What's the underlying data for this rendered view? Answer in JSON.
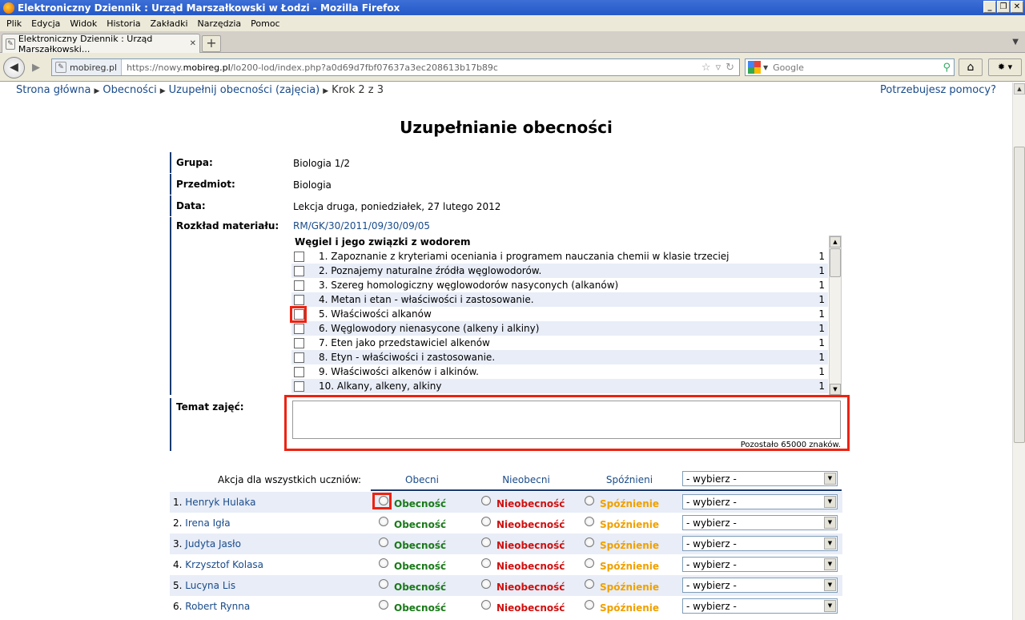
{
  "window": {
    "title": "Elektroniczny Dziennik : Urząd Marszałkowski w Łodzi - Mozilla Firefox",
    "buttons": [
      "_",
      "❐",
      "✕"
    ]
  },
  "menu": [
    "Plik",
    "Edycja",
    "Widok",
    "Historia",
    "Zakładki",
    "Narzędzia",
    "Pomoc"
  ],
  "tab": {
    "label": "Elektroniczny Dziennik : Urząd Marszałkowski..."
  },
  "urlbar": {
    "site": "mobireg.pl",
    "url_prefix": "https://nowy.",
    "url_domain": "mobireg.pl",
    "url_rest": "/lo200-lod/index.php?a0d69d7fbf07637a3ec208613b17b89c"
  },
  "search": {
    "placeholder": "Google"
  },
  "breadcrumb": {
    "items": [
      "Strona główna",
      "Obecności",
      "Uzupełnij obecności (zajęcia)"
    ],
    "current": "Krok 2 z 3"
  },
  "help_link": "Potrzebujesz pomocy?",
  "page_title": "Uzupełnianie obecności",
  "fields": {
    "group_label": "Grupa:",
    "group_value": "Biologia 1/2",
    "subject_label": "Przedmiot:",
    "subject_value": "Biologia",
    "date_label": "Data:",
    "date_value": "Lekcja druga, poniedziałek, 27 lutego 2012",
    "plan_label": "Rozkład materiału:",
    "plan_value": "RM/GK/30/2011/09/30/09/05",
    "topic_label": "Temat zajęć:"
  },
  "material": {
    "title": "Węgiel i jego związki z wodorem",
    "items": [
      {
        "label": "1. Zapoznanie z kryteriami oceniania i programem nauczania chemii w klasie trzeciej",
        "hours": "1"
      },
      {
        "label": "2. Poznajemy naturalne źródła węglowodorów.",
        "hours": "1"
      },
      {
        "label": "3. Szereg homologiczny węglowodorów nasyconych (alkanów)",
        "hours": "1"
      },
      {
        "label": "4. Metan i etan - właściwości i zastosowanie.",
        "hours": "1"
      },
      {
        "label": "5. Właściwości alkanów",
        "hours": "1"
      },
      {
        "label": "6. Węglowodory nienasycone (alkeny i alkiny)",
        "hours": "1"
      },
      {
        "label": "7. Eten jako przedstawiciel alkenów",
        "hours": "1"
      },
      {
        "label": "8. Etyn - właściwości i zastosowanie.",
        "hours": "1"
      },
      {
        "label": "9. Właściwości alkenów i alkinów.",
        "hours": "1"
      },
      {
        "label": "10. Alkany, alkeny, alkiny",
        "hours": "1"
      }
    ]
  },
  "topic_remaining": "Pozostało 65000 znaków.",
  "bulk": {
    "label": "Akcja dla wszystkich uczniów:",
    "col_present": "Obecni",
    "col_absent": "Nieobecni",
    "col_late": "Spóźnieni",
    "select_value": "- wybierz -"
  },
  "students": [
    {
      "num": "1.",
      "name": "Henryk Hulaka"
    },
    {
      "num": "2.",
      "name": "Irena Igła"
    },
    {
      "num": "3.",
      "name": "Judyta Jasło"
    },
    {
      "num": "4.",
      "name": "Krzysztof Kolasa"
    },
    {
      "num": "5.",
      "name": "Lucyna Lis"
    },
    {
      "num": "6.",
      "name": "Robert Rynna"
    }
  ],
  "options": {
    "present": "Obecność",
    "absent": "Nieobecność",
    "late": "Spóźnienie",
    "select": "- wybierz -"
  },
  "colors": {
    "present": "#1a7a1a",
    "absent": "#d01010",
    "late": "#f0a000",
    "link": "#1a4b8a",
    "highlight": "#e21111"
  }
}
